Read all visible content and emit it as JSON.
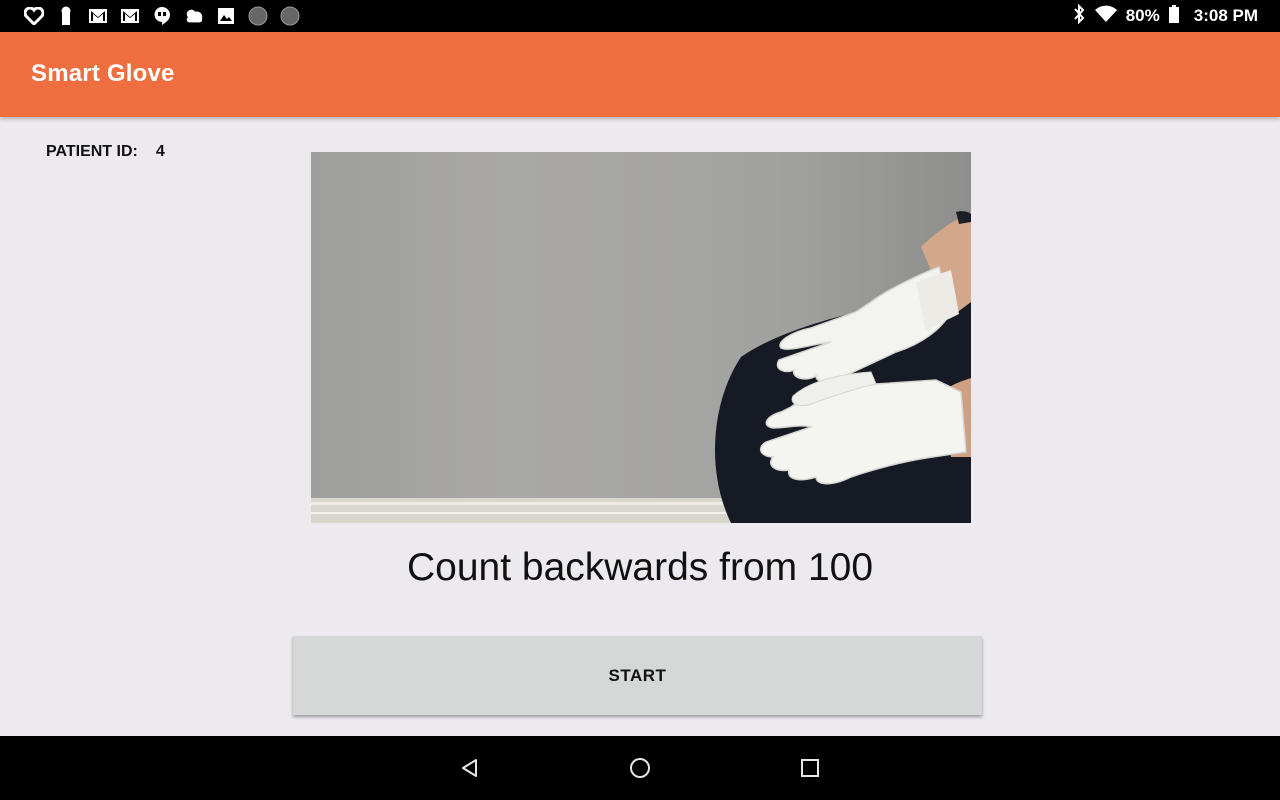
{
  "status_bar": {
    "notification_icons": [
      "heart-icon",
      "lock-keyhole-icon",
      "gmail-icon",
      "gmail-icon",
      "hangouts-icon",
      "weather-icon",
      "gallery-icon",
      "circle-icon",
      "circle-icon"
    ],
    "battery_percent": "80%",
    "time": "3:08 PM"
  },
  "app_bar": {
    "title": "Smart Glove",
    "color": "#ef6e3f"
  },
  "patient": {
    "label": "PATIENT ID:",
    "value": "4"
  },
  "video": {
    "description_icon": "video-frame"
  },
  "instruction": "Count backwards from 100",
  "start_button": {
    "label": "START"
  },
  "nav_bar": {
    "icons": [
      "back-icon",
      "home-icon",
      "recents-icon"
    ]
  }
}
